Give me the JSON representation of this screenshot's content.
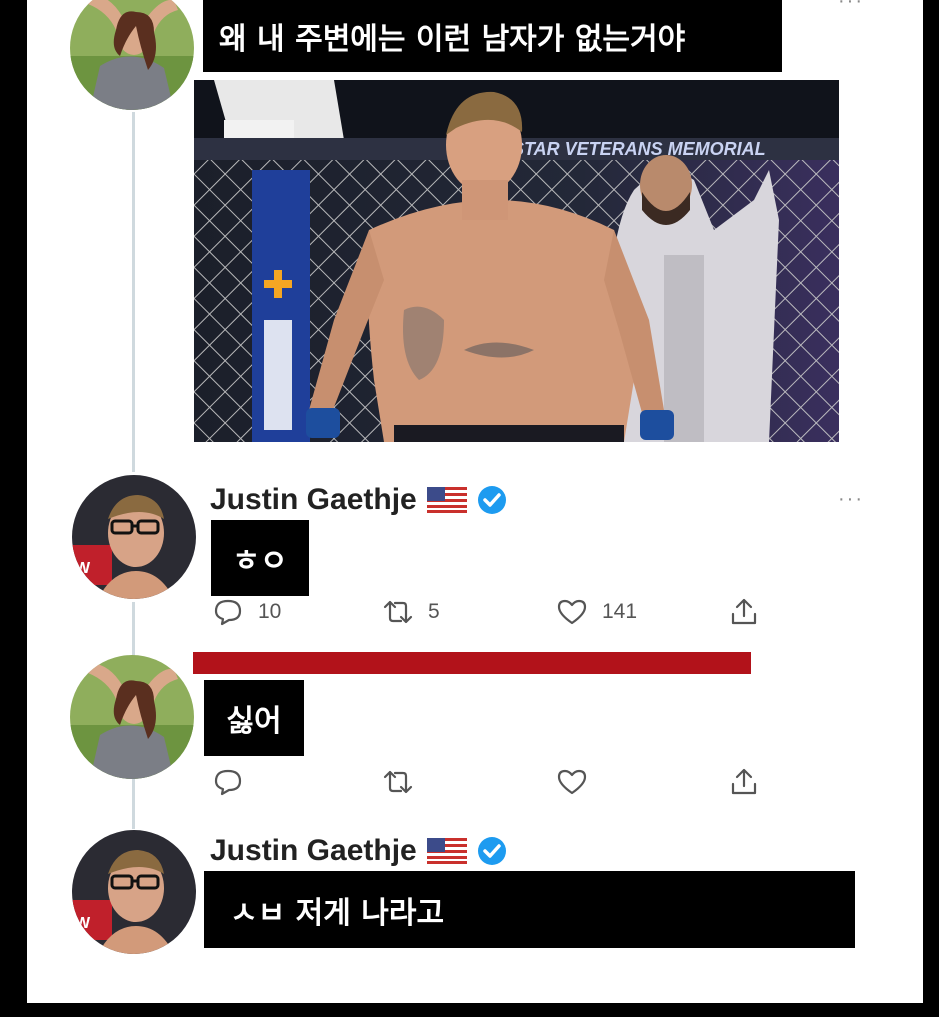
{
  "thread": {
    "post1": {
      "caption": "왜 내 주변에는 이런 남자가 없는거야",
      "more": "···"
    },
    "photo": {
      "cage_text": "STAR VETERANS MEMORIAL"
    },
    "reply1": {
      "author": "Justin Gaethje",
      "caption": "ㅎㅇ",
      "more": "···",
      "reply_count": "10",
      "retweet_count": "5",
      "like_count": "141"
    },
    "reply2": {
      "caption": "싫어"
    },
    "reply3": {
      "author": "Justin Gaethje",
      "caption": "ㅅㅂ 저게 나라고"
    }
  },
  "colors": {
    "verified": "#1d9bf0",
    "caption_bg": "#000000",
    "caption_text": "#ffffff",
    "censor_bar": "#b2121a"
  },
  "icons": [
    "reply-icon",
    "retweet-icon",
    "like-icon",
    "share-icon",
    "verified-badge-icon",
    "us-flag-icon"
  ]
}
